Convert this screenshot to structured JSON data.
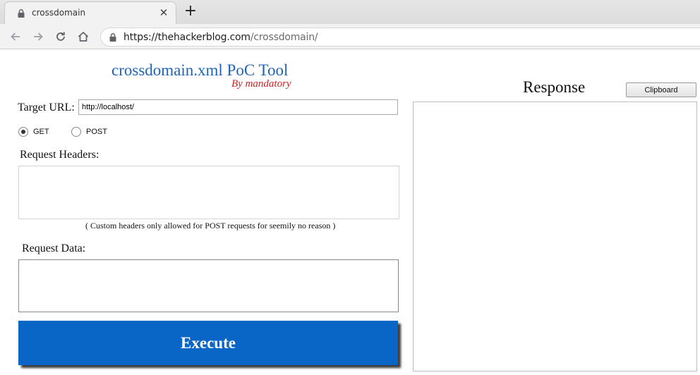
{
  "browser": {
    "tab": {
      "title": "crossdomain",
      "close_glyph": "✕"
    },
    "new_tab_glyph": "+",
    "address": {
      "host": "https://thehackerblog.com",
      "path": "/crossdomain/"
    },
    "icons": [
      "lock-icon",
      "back-arrow-icon",
      "forward-arrow-icon",
      "reload-icon",
      "home-icon"
    ]
  },
  "app": {
    "title": "crossdomain.xml PoC Tool",
    "subtitle": "By mandatory"
  },
  "form": {
    "target_url_label": "Target URL:",
    "target_url_value": "http://localhost/",
    "methods": [
      {
        "label": "GET",
        "checked": true
      },
      {
        "label": "POST",
        "checked": false
      }
    ],
    "headers_label": "Request Headers:",
    "headers_value": "",
    "headers_note": "( Custom headers only allowed for POST requests for seemily no reason )",
    "data_label": "Request Data:",
    "data_value": "",
    "execute_label": "Execute"
  },
  "response": {
    "title": "Response",
    "clipboard_label": "Clipboard",
    "content": ""
  },
  "colors": {
    "title_blue": "#1e64b4",
    "subtitle_red": "#cc2020",
    "execute_blue": "#0a66c6"
  }
}
